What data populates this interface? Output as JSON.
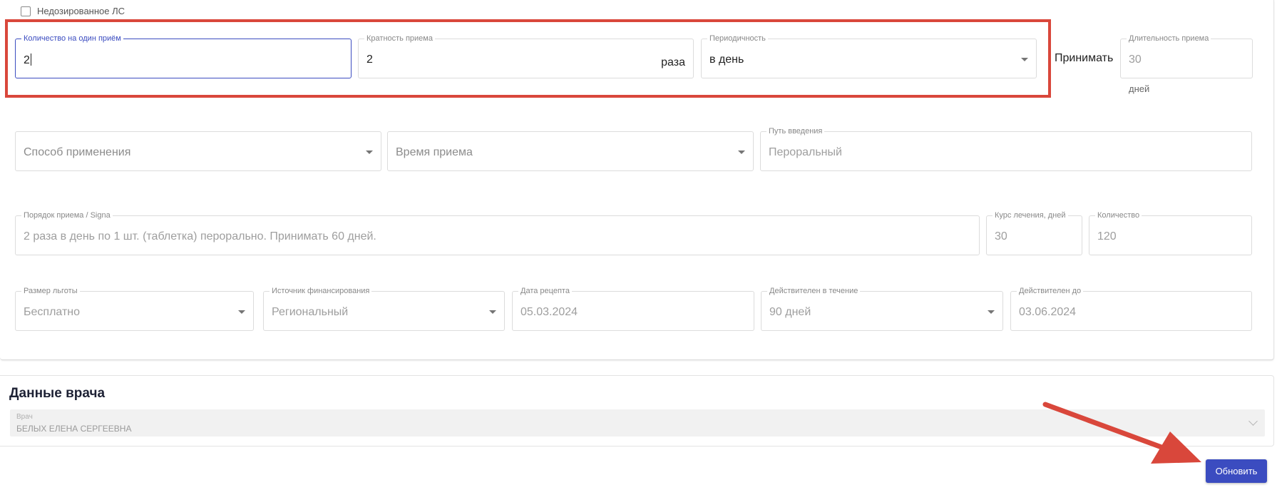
{
  "checkbox": {
    "label": "Недозированное ЛС",
    "checked": false
  },
  "dosing": {
    "quantity_per_dose": {
      "label": "Количество на один приём",
      "value": "2"
    },
    "frequency": {
      "label": "Кратность приема",
      "value": "2",
      "suffix": "раза"
    },
    "periodicity": {
      "label": "Периодичность",
      "value": "в день"
    },
    "take_label": "Принимать",
    "duration": {
      "label": "Длительность приема",
      "value": "30",
      "unit": "дней"
    }
  },
  "administration": {
    "method": {
      "placeholder": "Способ применения"
    },
    "time": {
      "placeholder": "Время приема"
    },
    "route": {
      "label": "Путь введения",
      "value": "Пероральный"
    }
  },
  "signa": {
    "order": {
      "label": "Порядок приема / Signa",
      "value": "2 раза в день по 1 шт. (таблетка) перорально. Принимать 60 дней."
    },
    "course": {
      "label": "Курс лечения, дней",
      "value": "30"
    },
    "amount": {
      "label": "Количество",
      "value": "120"
    }
  },
  "benefits": {
    "size": {
      "label": "Размер льготы",
      "value": "Бесплатно"
    },
    "source": {
      "label": "Источник финансирования",
      "value": "Региональный"
    },
    "date": {
      "label": "Дата рецепта",
      "value": "05.03.2024"
    },
    "valid_for": {
      "label": "Действителен в течение",
      "value": "90 дней"
    },
    "valid_until": {
      "label": "Действителен до",
      "value": "03.06.2024"
    }
  },
  "doctor": {
    "title": "Данные врача",
    "field_label": "Врач",
    "value": "БЕЛЫХ ЕЛЕНА СЕРГЕЕВНА"
  },
  "actions": {
    "update_label": "Обновить"
  },
  "colors": {
    "accent": "#3b4cc0",
    "annotation": "#d9473b"
  }
}
